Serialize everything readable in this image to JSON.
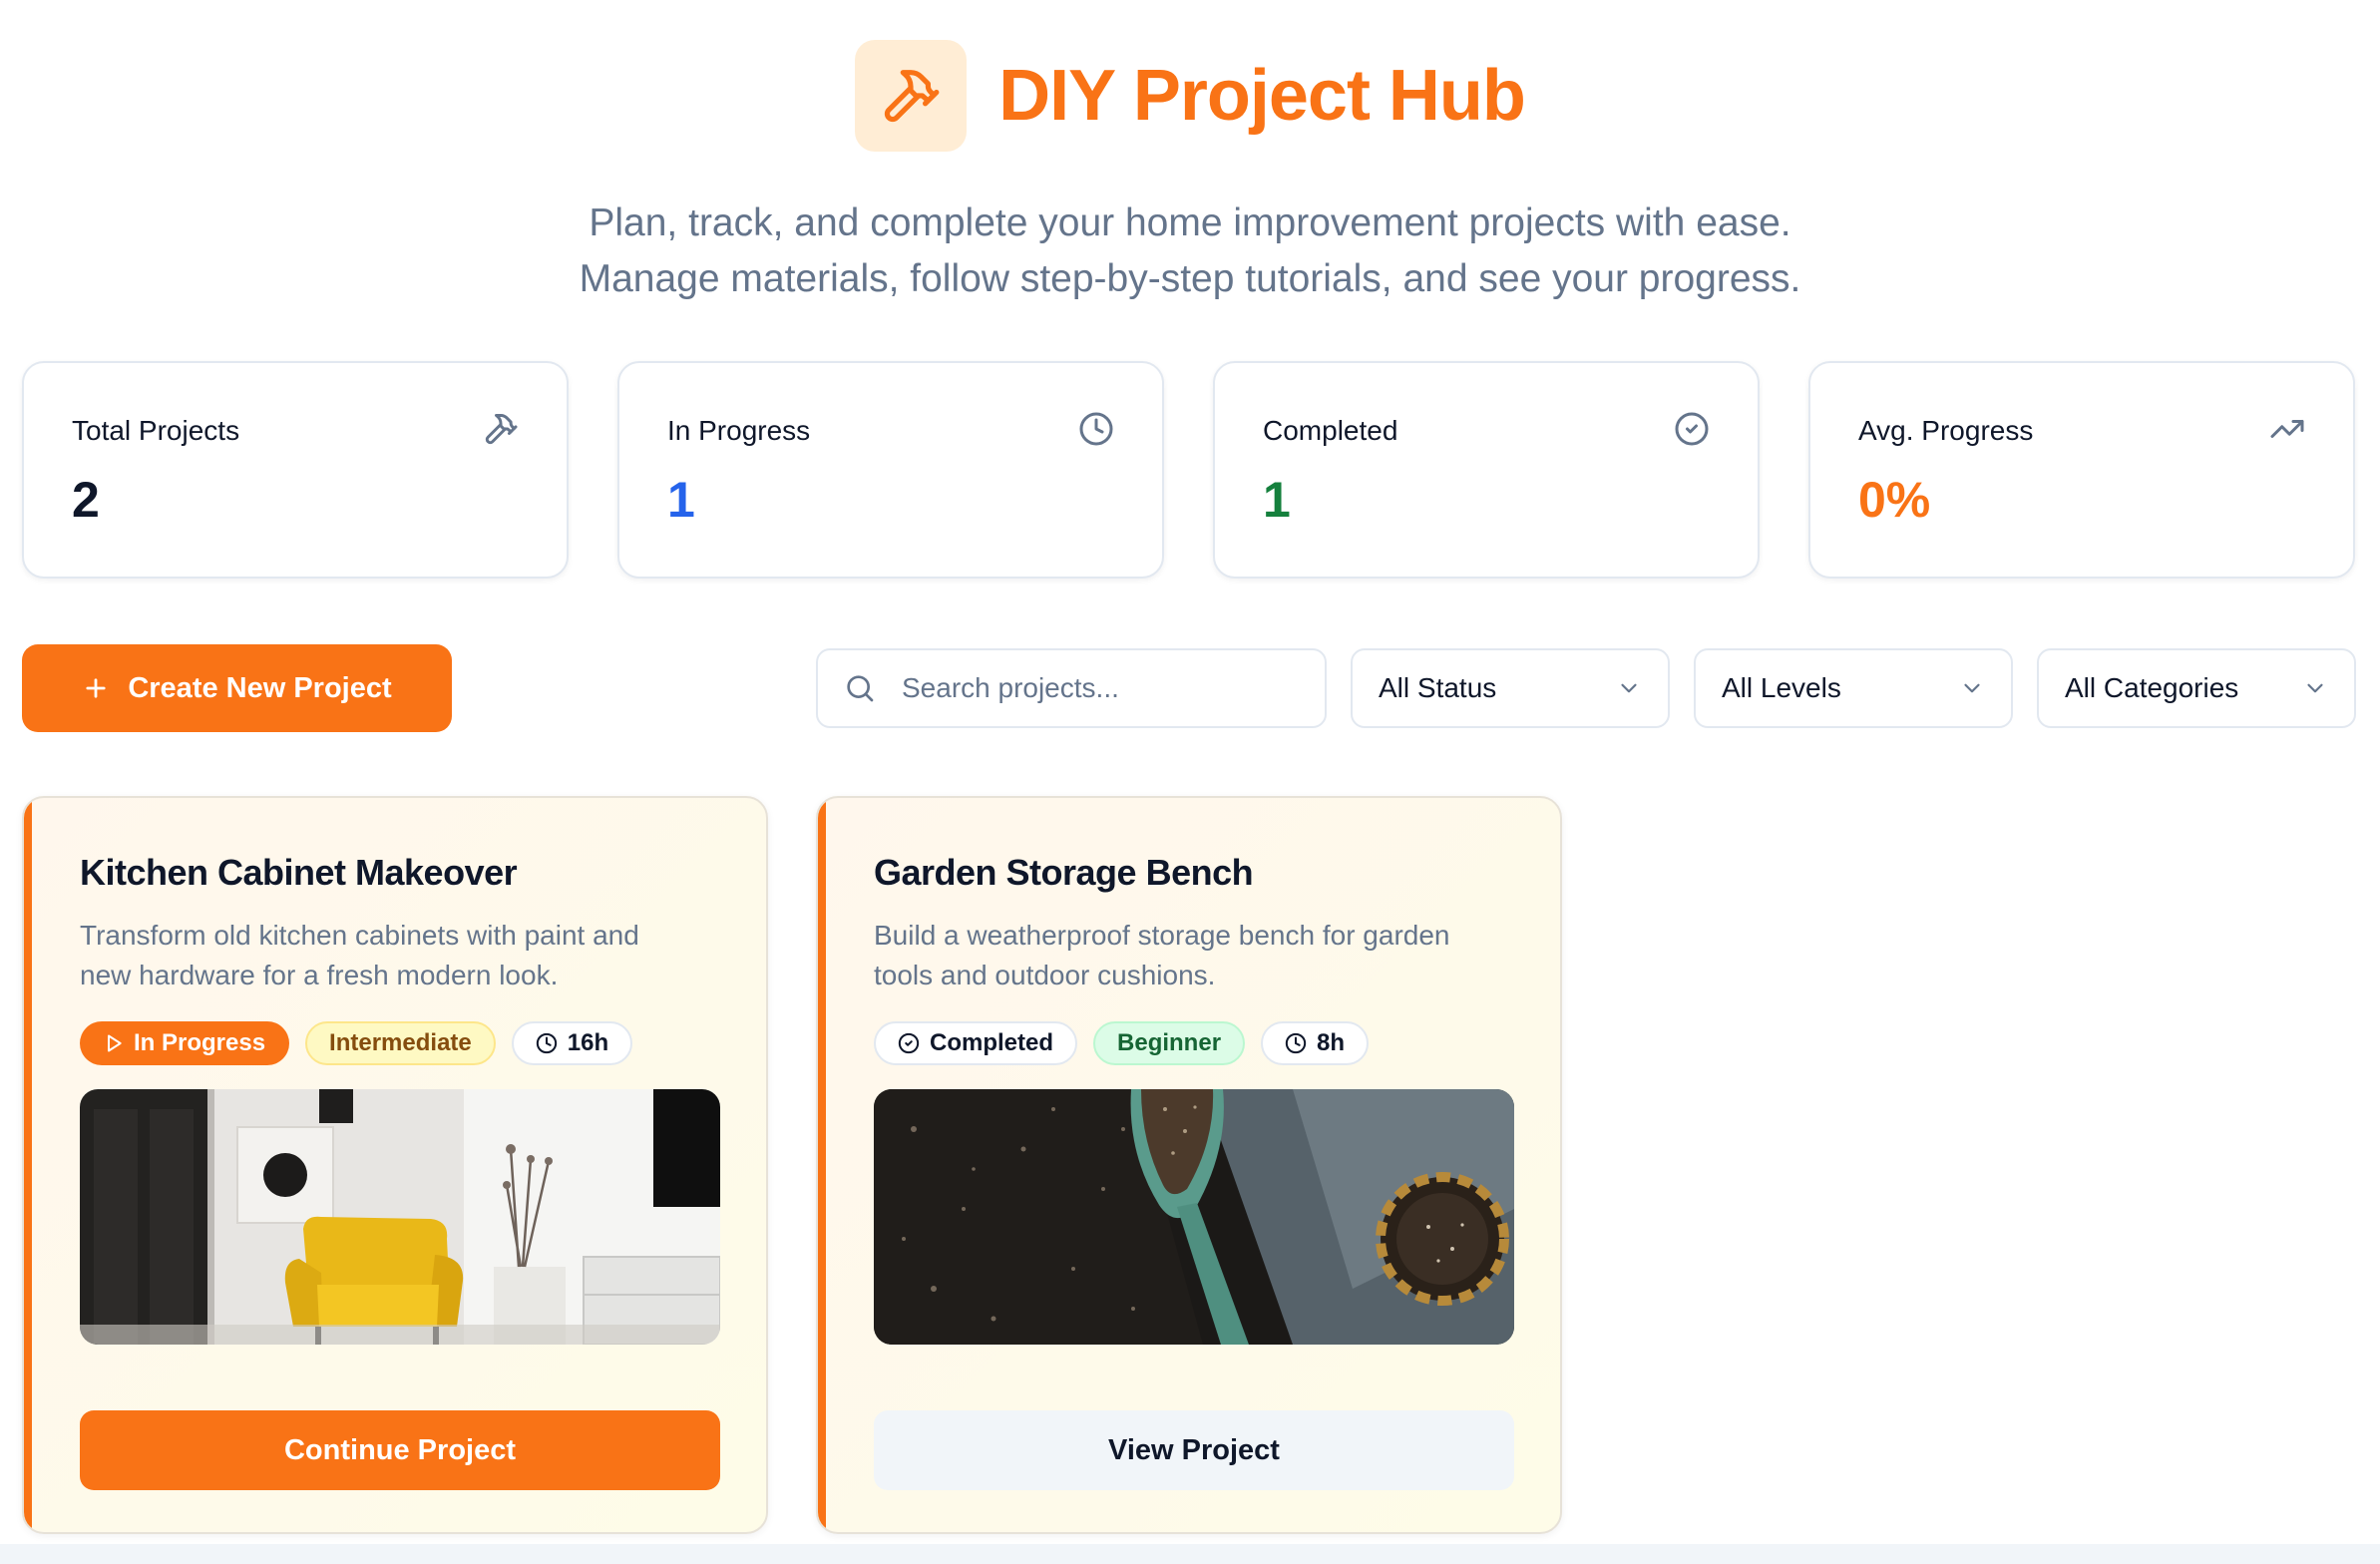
{
  "header": {
    "title": "DIY Project Hub",
    "subtitle_line1": "Plan, track, and complete your home improvement projects with ease.",
    "subtitle_line2": "Manage materials, follow step-by-step tutorials, and see your progress."
  },
  "stats": [
    {
      "label": "Total Projects",
      "value": "2",
      "icon": "hammer-icon",
      "color": "#0f172a"
    },
    {
      "label": "In Progress",
      "value": "1",
      "icon": "clock-icon",
      "color": "#2563eb"
    },
    {
      "label": "Completed",
      "value": "1",
      "icon": "check-circle-icon",
      "color": "#15803d"
    },
    {
      "label": "Avg. Progress",
      "value": "0%",
      "icon": "trending-up-icon",
      "color": "#f97316"
    }
  ],
  "toolbar": {
    "create_label": "Create New Project",
    "search_placeholder": "Search projects...",
    "status_filter": "All Status",
    "level_filter": "All Levels",
    "category_filter": "All Categories"
  },
  "projects": [
    {
      "title": "Kitchen Cabinet Makeover",
      "description": "Transform old kitchen cabinets with paint and new hardware for a fresh modern look.",
      "status": "In Progress",
      "level": "Intermediate",
      "time": "16h",
      "image": "living-room-yellow-armchair",
      "button": "Continue Project"
    },
    {
      "title": "Garden Storage Bench",
      "description": "Build a weatherproof storage bench for garden tools and outdoor cushions.",
      "status": "Completed",
      "level": "Beginner",
      "time": "8h",
      "image": "garden-trowel-soil",
      "button": "View Project"
    }
  ],
  "colors": {
    "accent": "#f97316",
    "accent_light": "#ffedd5",
    "muted_text": "#64748b"
  }
}
